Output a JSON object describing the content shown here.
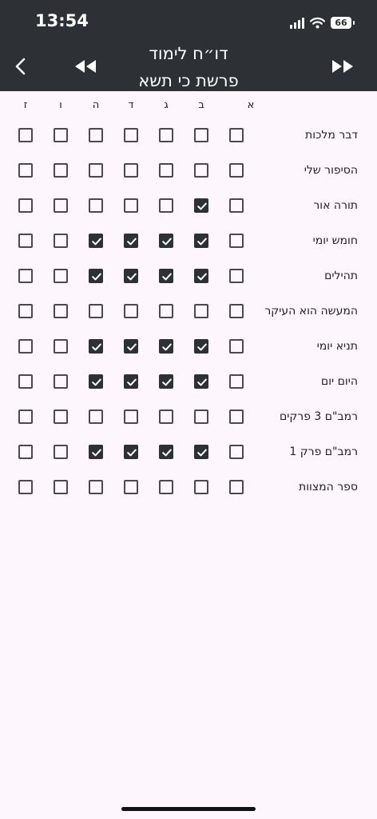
{
  "status_bar": {
    "time": "13:54",
    "battery": "66"
  },
  "header": {
    "title": "דו״ח לימוד",
    "subtitle": "פרשת כי תשא"
  },
  "days": [
    "א",
    "ב",
    "ג",
    "ד",
    "ה",
    "ו",
    "ז"
  ],
  "rows": [
    {
      "label": "דבר מלכות",
      "checks": [
        false,
        false,
        false,
        false,
        false,
        false,
        false
      ]
    },
    {
      "label": "הסיפור שלי",
      "checks": [
        false,
        false,
        false,
        false,
        false,
        false,
        false
      ]
    },
    {
      "label": "תורה אור",
      "checks": [
        false,
        true,
        false,
        false,
        false,
        false,
        false
      ]
    },
    {
      "label": "חומש יומי",
      "checks": [
        false,
        true,
        true,
        true,
        true,
        false,
        false
      ]
    },
    {
      "label": "תהילים",
      "checks": [
        false,
        true,
        true,
        true,
        true,
        false,
        false
      ]
    },
    {
      "label": "המעשה הוא העיקר",
      "checks": [
        false,
        false,
        false,
        false,
        false,
        false,
        false
      ]
    },
    {
      "label": "תניא יומי",
      "checks": [
        false,
        true,
        true,
        true,
        true,
        false,
        false
      ]
    },
    {
      "label": "היום יום",
      "checks": [
        false,
        true,
        true,
        true,
        true,
        false,
        false
      ]
    },
    {
      "label": "רמב\"ם 3 פרקים",
      "checks": [
        false,
        false,
        false,
        false,
        false,
        false,
        false
      ]
    },
    {
      "label": "רמב\"ם פרק 1",
      "checks": [
        false,
        true,
        true,
        true,
        true,
        false,
        false
      ]
    },
    {
      "label": "ספר המצוות",
      "checks": [
        false,
        false,
        false,
        false,
        false,
        false,
        false
      ]
    }
  ],
  "icons": {
    "back": "chevron-left-icon",
    "previous": "rewind-icon",
    "next": "fast-forward-icon",
    "checked": "checkbox-checked-icon",
    "unchecked": "checkbox-empty-icon"
  },
  "colors": {
    "header_bg": "#2d3034",
    "page_bg": "#fdf6fc",
    "check_fill": "#2d3034"
  }
}
